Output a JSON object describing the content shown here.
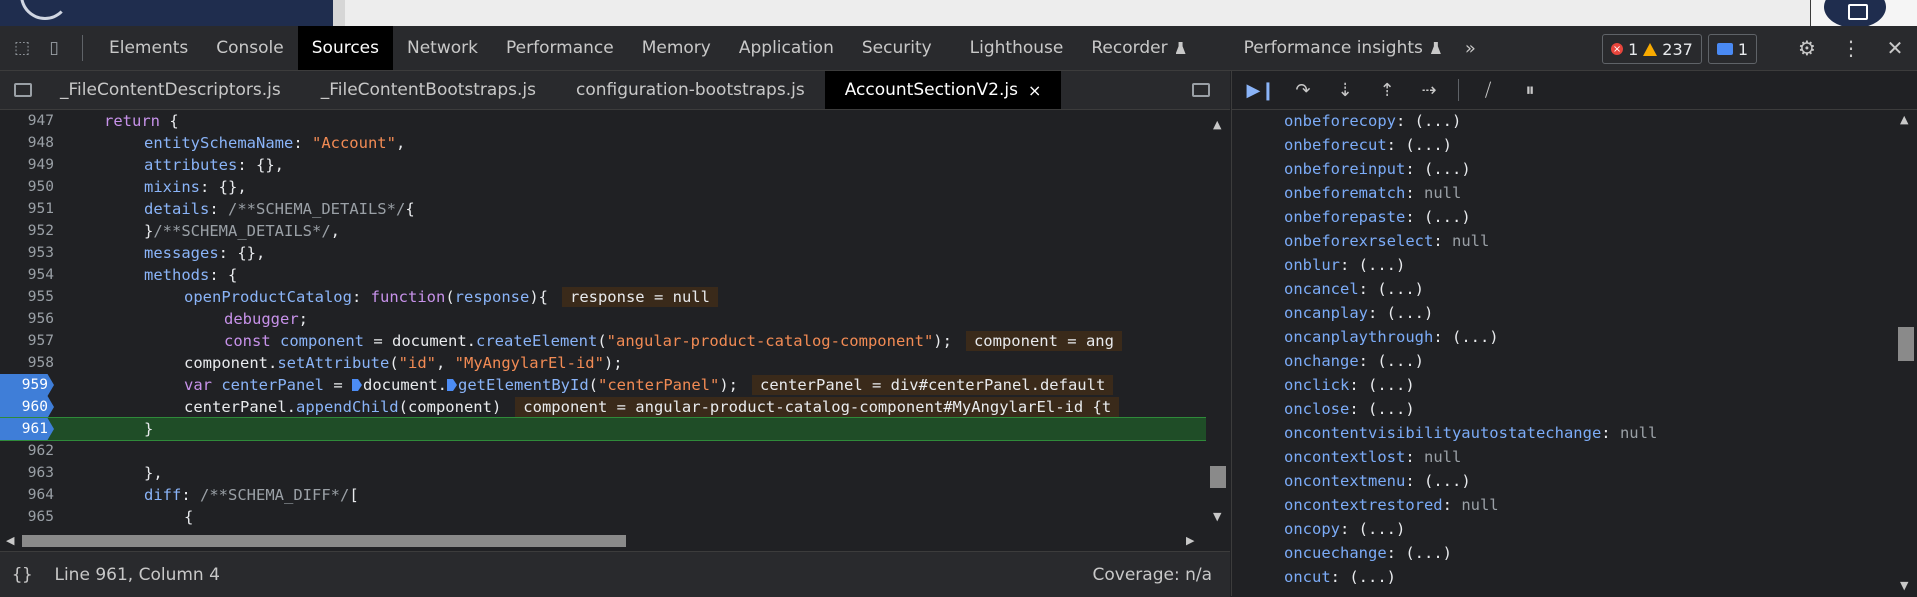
{
  "tabs": [
    "Elements",
    "Console",
    "Sources",
    "Network",
    "Performance",
    "Memory",
    "Application",
    "Security",
    "Lighthouse",
    "Recorder",
    "Performance insights"
  ],
  "active_tab": "Sources",
  "badges": {
    "errors": "1",
    "warnings": "237",
    "messages": "1"
  },
  "files": [
    "_FileContentDescriptors.js",
    "_FileContentBootstraps.js",
    "configuration-bootstraps.js",
    "AccountSectionV2.js"
  ],
  "active_file_close": "×",
  "lines": [
    {
      "n": "947",
      "parts": [
        [
          "k",
          "return"
        ],
        [
          "v",
          " {"
        ]
      ]
    },
    {
      "n": "948",
      "parts": [
        [
          "p",
          "entitySchemaName"
        ],
        [
          "v",
          ": "
        ],
        [
          "s",
          "\"Account\""
        ],
        [
          "v",
          ","
        ]
      ]
    },
    {
      "n": "949",
      "parts": [
        [
          "p",
          "attributes"
        ],
        [
          "v",
          ": {},"
        ]
      ]
    },
    {
      "n": "950",
      "parts": [
        [
          "p",
          "mixins"
        ],
        [
          "v",
          ": {},"
        ]
      ]
    },
    {
      "n": "951",
      "parts": [
        [
          "p",
          "details"
        ],
        [
          "v",
          ": "
        ],
        [
          "c",
          "/**SCHEMA_DETAILS*/"
        ],
        [
          "v",
          "{"
        ]
      ]
    },
    {
      "n": "952",
      "parts": [
        [
          "v",
          "}"
        ],
        [
          "c",
          "/**SCHEMA_DETAILS*/"
        ],
        [
          "v",
          ","
        ]
      ]
    },
    {
      "n": "953",
      "parts": [
        [
          "p",
          "messages"
        ],
        [
          "v",
          ": {},"
        ]
      ]
    },
    {
      "n": "954",
      "parts": [
        [
          "p",
          "methods"
        ],
        [
          "v",
          ": {"
        ]
      ]
    },
    {
      "n": "955",
      "parts": [
        [
          "p",
          "openProductCatalog"
        ],
        [
          "v",
          ": "
        ],
        [
          "k",
          "function"
        ],
        [
          "v",
          "("
        ],
        [
          "p",
          "response"
        ],
        [
          "v",
          "){"
        ]
      ],
      "inline": "response = null"
    },
    {
      "n": "956",
      "parts": [
        [
          "k",
          "debugger"
        ],
        [
          "v",
          ";"
        ]
      ]
    },
    {
      "n": "957",
      "parts": [
        [
          "k",
          "const"
        ],
        [
          "v",
          " "
        ],
        [
          "p",
          "component"
        ],
        [
          "v",
          " = document."
        ],
        [
          "f",
          "createElement"
        ],
        [
          "v",
          "("
        ],
        [
          "s",
          "\"angular-product-catalog-component\""
        ],
        [
          "v",
          ");"
        ]
      ],
      "inline": "component = ang"
    },
    {
      "n": "958",
      "parts": [
        [
          "v",
          "component."
        ],
        [
          "f",
          "setAttribute"
        ],
        [
          "v",
          "("
        ],
        [
          "s",
          "\"id\""
        ],
        [
          "v",
          ", "
        ],
        [
          "s",
          "\"MyAngylarEl-id\""
        ],
        [
          "v",
          ");"
        ]
      ]
    },
    {
      "n": "959",
      "parts": [
        [
          "k",
          "var"
        ],
        [
          "v",
          " "
        ],
        [
          "p",
          "centerPanel"
        ],
        [
          "v",
          " = "
        ],
        [
          "m",
          ""
        ],
        [
          "v",
          "document."
        ],
        [
          "m",
          ""
        ],
        [
          "f",
          "getElementById"
        ],
        [
          "v",
          "("
        ],
        [
          "s",
          "\"centerPanel\""
        ],
        [
          "v",
          ");"
        ]
      ],
      "inline": "centerPanel = div#centerPanel.default"
    },
    {
      "n": "960",
      "parts": [
        [
          "v",
          "centerPanel."
        ],
        [
          "f",
          "appendChild"
        ],
        [
          "v",
          "(component)"
        ]
      ],
      "inline": "component = angular-product-catalog-component#MyAngylarEl-id {t"
    },
    {
      "n": "961",
      "parts": [
        [
          "v",
          "}"
        ]
      ]
    },
    {
      "n": "962",
      "parts": []
    },
    {
      "n": "963",
      "parts": [
        [
          "v",
          "},"
        ]
      ]
    },
    {
      "n": "964",
      "parts": [
        [
          "p",
          "diff"
        ],
        [
          "v",
          ": "
        ],
        [
          "c",
          "/**SCHEMA_DIFF*/"
        ],
        [
          "v",
          "["
        ]
      ]
    },
    {
      "n": "965",
      "parts": [
        [
          "v",
          "{"
        ]
      ]
    }
  ],
  "status": {
    "position": "Line 961, Column 4",
    "coverage": "Coverage: n/a",
    "pretty": "{}"
  },
  "scope_props": [
    [
      "onbeforecopy",
      "(...)"
    ],
    [
      "onbeforecut",
      "(...)"
    ],
    [
      "onbeforeinput",
      "(...)"
    ],
    [
      "onbeforematch",
      "null"
    ],
    [
      "onbeforepaste",
      "(...)"
    ],
    [
      "onbeforexrselect",
      "null"
    ],
    [
      "onblur",
      "(...)"
    ],
    [
      "oncancel",
      "(...)"
    ],
    [
      "oncanplay",
      "(...)"
    ],
    [
      "oncanplaythrough",
      "(...)"
    ],
    [
      "onchange",
      "(...)"
    ],
    [
      "onclick",
      "(...)"
    ],
    [
      "onclose",
      "(...)"
    ],
    [
      "oncontentvisibilityautostatechange",
      "null"
    ],
    [
      "oncontextlost",
      "null"
    ],
    [
      "oncontextmenu",
      "(...)"
    ],
    [
      "oncontextrestored",
      "null"
    ],
    [
      "oncopy",
      "(...)"
    ],
    [
      "oncuechange",
      "(...)"
    ],
    [
      "oncut",
      "(...)"
    ]
  ]
}
